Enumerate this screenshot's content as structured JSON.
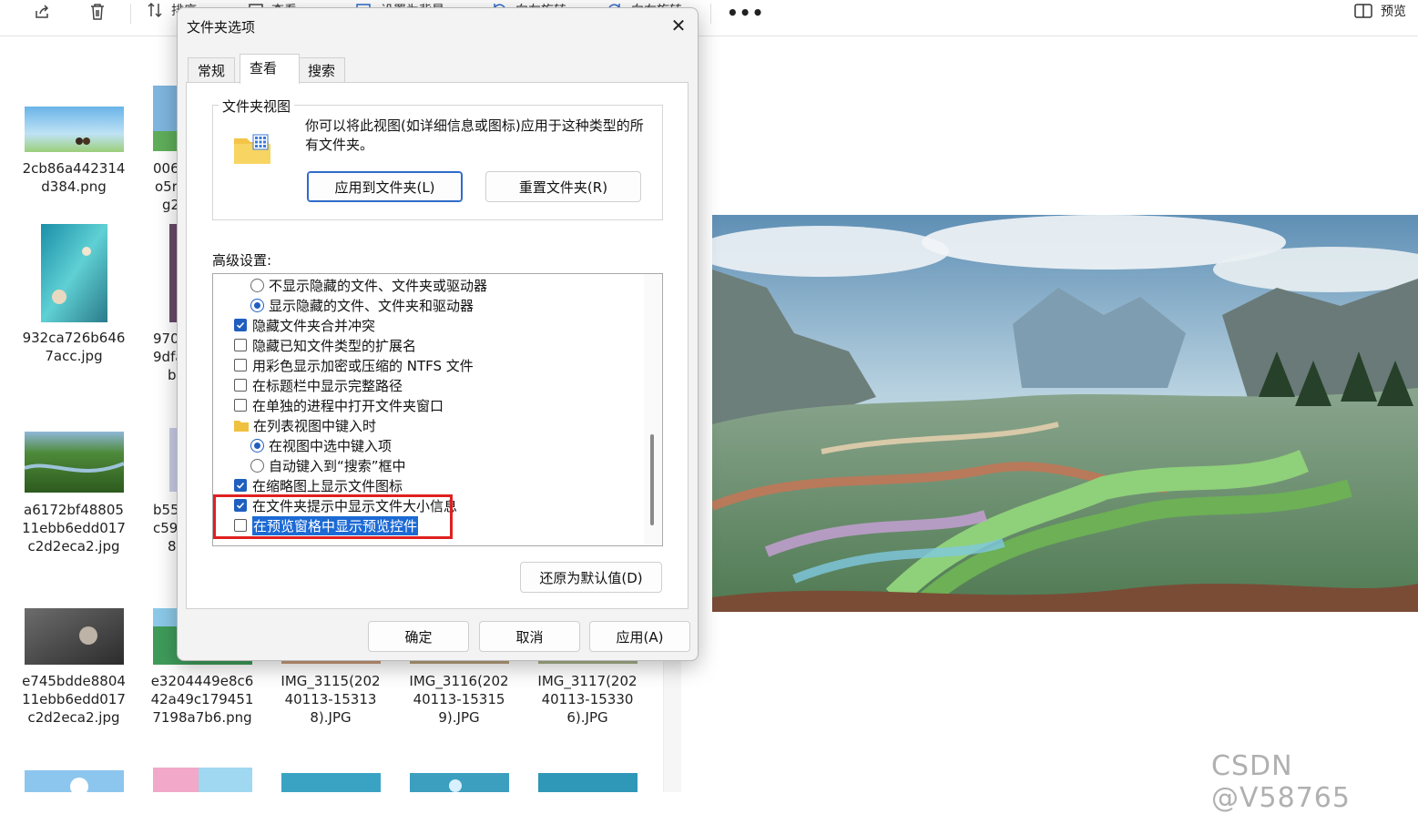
{
  "toolbar": {
    "sort_label": "排序",
    "view_label": "查看",
    "set_bg_label": "设置为背景",
    "rotate_left_label": "向左旋转",
    "rotate_right_label": "向右旋转",
    "more_label": "•••",
    "preview_label": "预览"
  },
  "files": [
    {
      "name": "2cb86a442314d384.png"
    },
    {
      "name": "932ca726b6467acc.jpg"
    },
    {
      "name": "a6172bf4880511ebb6edd017c2d2eca2.jpg"
    },
    {
      "name": "e745bdde880411ebb6edd017c2d2eca2.jpg"
    },
    {
      "name": "e3204449e8c642a49c1794517198a7b6.png"
    },
    {
      "name": "IMG_3115(20240113-153138).JPG"
    },
    {
      "name": "IMG_3116(20240113-153159).JPG"
    },
    {
      "name": "IMG_3117(20240113-153306).JPG"
    }
  ],
  "partial_files": [
    "006",
    "o5r",
    "g2",
    "970",
    "9dfa",
    "b",
    "b55",
    "c59",
    "8"
  ],
  "dialog": {
    "title": "文件夹选项",
    "close_label": "✕",
    "tabs": [
      "常规",
      "查看",
      "搜索"
    ],
    "group_title": "文件夹视图",
    "group_desc": "你可以将此视图(如详细信息或图标)应用于这种类型的所有文件夹。",
    "apply_folders_label": "应用到文件夹(L)",
    "reset_folders_label": "重置文件夹(R)",
    "advanced_label": "高级设置:",
    "advanced_items": [
      {
        "kind": "radio",
        "checked": false,
        "label": "不显示隐藏的文件、文件夹或驱动器"
      },
      {
        "kind": "radio",
        "checked": true,
        "label": "显示隐藏的文件、文件夹和驱动器"
      },
      {
        "kind": "checkbox",
        "checked": true,
        "label": "隐藏文件夹合并冲突"
      },
      {
        "kind": "checkbox",
        "checked": false,
        "label": "隐藏已知文件类型的扩展名"
      },
      {
        "kind": "checkbox",
        "checked": false,
        "label": "用彩色显示加密或压缩的 NTFS 文件"
      },
      {
        "kind": "checkbox",
        "checked": false,
        "label": "在标题栏中显示完整路径"
      },
      {
        "kind": "checkbox",
        "checked": false,
        "label": "在单独的进程中打开文件夹窗口"
      },
      {
        "kind": "folder",
        "checked": false,
        "label": "在列表视图中键入时"
      },
      {
        "kind": "radio",
        "checked": true,
        "label": "在视图中选中键入项"
      },
      {
        "kind": "radio",
        "checked": false,
        "label": "自动键入到“搜索”框中"
      },
      {
        "kind": "checkbox",
        "checked": true,
        "label": "在缩略图上显示文件图标"
      },
      {
        "kind": "checkbox",
        "checked": true,
        "label": "在文件夹提示中显示文件大小信息"
      },
      {
        "kind": "checkbox",
        "checked": false,
        "label": "在预览窗格中显示预览控件"
      }
    ],
    "restore_defaults_label": "还原为默认值(D)",
    "ok_label": "确定",
    "cancel_label": "取消",
    "apply_label": "应用(A)"
  },
  "watermark": "CSDN @V58765",
  "colors": {
    "accent": "#1f5fbf",
    "highlight_border": "#e02020",
    "selection": "#1c6ad4"
  }
}
